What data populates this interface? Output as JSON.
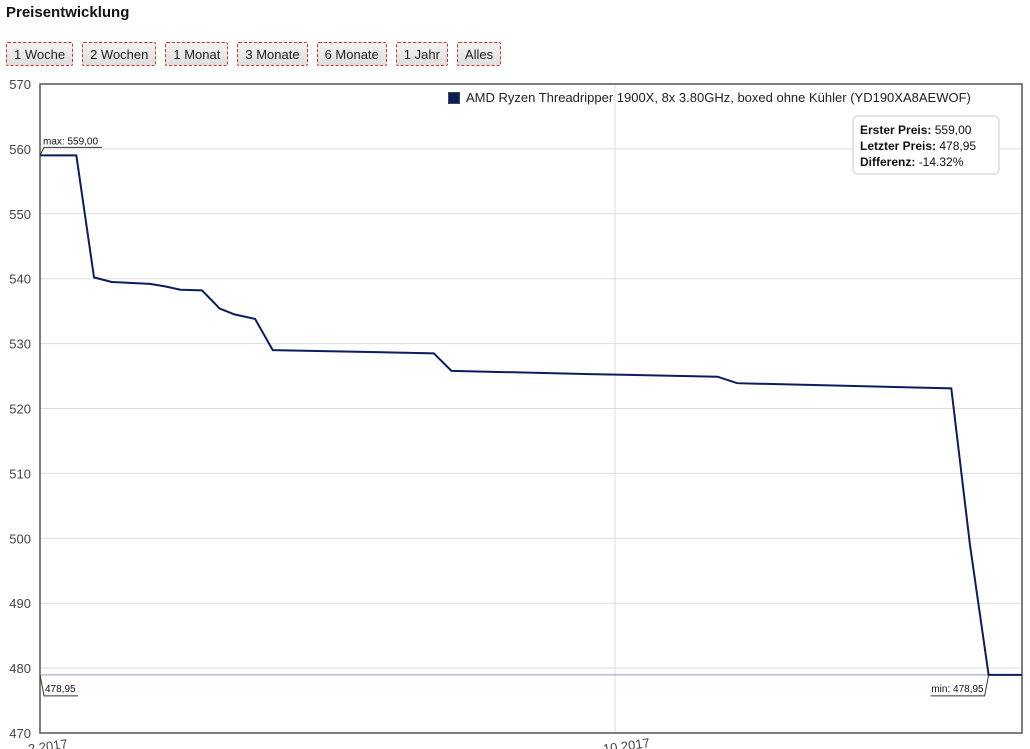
{
  "page": {
    "title": "Preisentwicklung"
  },
  "range_buttons": [
    "1 Woche",
    "2 Wochen",
    "1 Monat",
    "3 Monate",
    "6 Monate",
    "1 Jahr",
    "Alles"
  ],
  "legend": {
    "label": "AMD Ryzen Threadripper 1900X, 8x 3.80GHz, boxed ohne Kühler (YD190XA8AEWOF)",
    "color": "#0b1d5a"
  },
  "info": {
    "first_label": "Erster Preis:",
    "first_value": "559,00",
    "last_label": "Letzter Preis:",
    "last_value": "478,95",
    "diff_label": "Differenz:",
    "diff_value": "-14.32%"
  },
  "annotations": {
    "max": "max: 559,00",
    "min": "min: 478,95",
    "last": "478,95"
  },
  "chart_data": {
    "type": "line",
    "ylim": [
      470,
      570
    ],
    "y_ticks": [
      470,
      480,
      490,
      500,
      510,
      520,
      530,
      540,
      550,
      560,
      570
    ],
    "x_tick_labels": [
      "...2.2017",
      "...10.2017"
    ],
    "reference_line": 478.95,
    "series": [
      {
        "name": "AMD Ryzen Threadripper 1900X, 8x 3.80GHz, boxed ohne Kühler (YD190XA8AEWOF)",
        "values": [
          559.0,
          559.0,
          540.2,
          539.5,
          539.2,
          538.8,
          538.3,
          538.2,
          535.4,
          534.5,
          533.8,
          529.0,
          528.5,
          525.8,
          525.3,
          524.9,
          523.9,
          523.1,
          499.0,
          478.95,
          478.95
        ]
      }
    ]
  }
}
